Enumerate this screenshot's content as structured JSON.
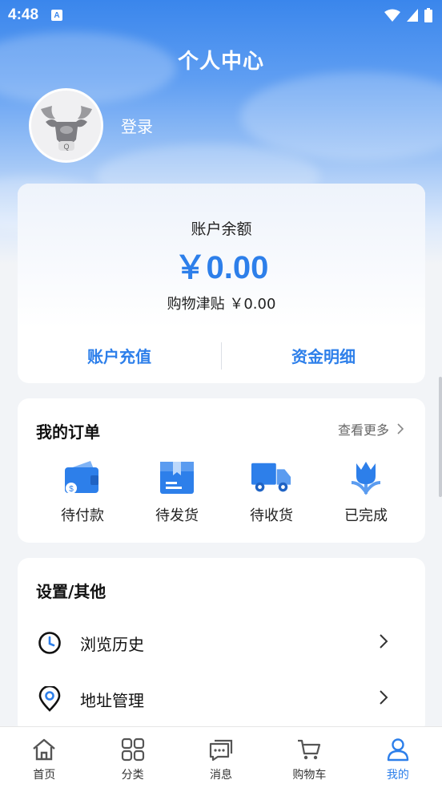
{
  "status_bar": {
    "time": "4:48",
    "notification_badge": "A"
  },
  "header": {
    "title": "个人中心",
    "login_label": "登录"
  },
  "balance": {
    "label": "账户余额",
    "value": "￥0.00",
    "subsidy": "购物津贴 ￥0.00",
    "recharge_label": "账户充值",
    "details_label": "资金明细"
  },
  "orders": {
    "title": "我的订单",
    "more_label": "查看更多",
    "items": [
      {
        "label": "待付款",
        "icon": "wallet-icon"
      },
      {
        "label": "待发货",
        "icon": "package-icon"
      },
      {
        "label": "待收货",
        "icon": "truck-icon"
      },
      {
        "label": "已完成",
        "icon": "flower-icon"
      }
    ]
  },
  "settings": {
    "title": "设置/其他",
    "items": [
      {
        "label": "浏览历史",
        "icon": "clock-icon"
      },
      {
        "label": "地址管理",
        "icon": "location-pin-icon"
      }
    ]
  },
  "tabbar": {
    "items": [
      {
        "label": "首页",
        "icon": "home-icon"
      },
      {
        "label": "分类",
        "icon": "grid-icon"
      },
      {
        "label": "消息",
        "icon": "chat-icon"
      },
      {
        "label": "购物车",
        "icon": "cart-icon"
      },
      {
        "label": "我的",
        "icon": "user-icon"
      }
    ],
    "active_index": 4
  },
  "colors": {
    "accent": "#2d7fea",
    "hero_top": "#3a86ec"
  }
}
